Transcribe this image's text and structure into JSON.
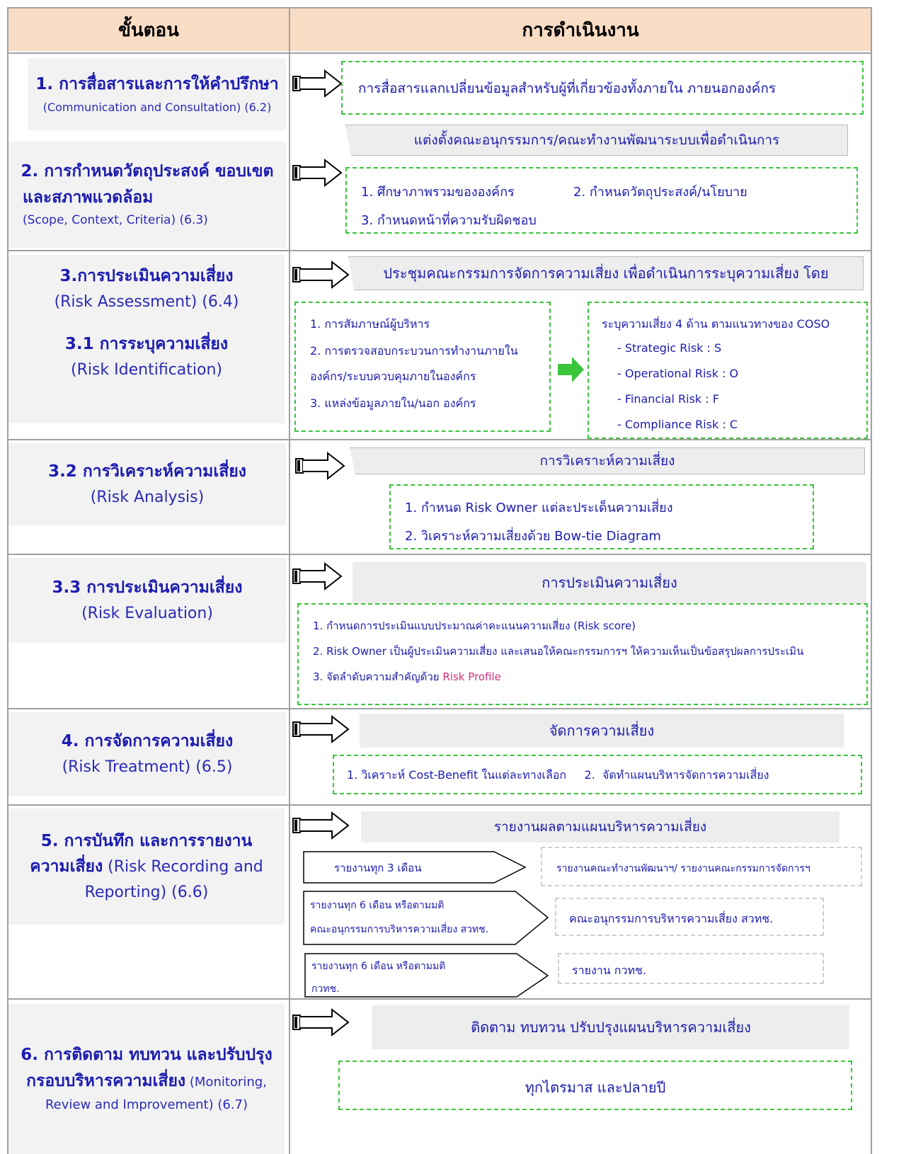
{
  "header": {
    "col1": "ขั้นตอน",
    "col2": "การดำเนินงาน"
  },
  "steps": {
    "s1": {
      "title": "1. การสื่อสารและการให้คำปรึกษา",
      "sub": "(Communication and Consultation) (6.2)",
      "box": "การสื่อสารแลกเปลี่ยนข้อมูลสำหรับผู้ที่เกี่ยวข้องทั้งภายใน ภายนอกองค์กร"
    },
    "s2": {
      "title1": "2. การกำหนดวัตถุประสงค์ ขอบเขต",
      "title2": "และสภาพแวดล้อม",
      "sub": "(Scope, Context, Criteria) (6.3)",
      "banner": "แต่งตั้งคณะอนุกรรมการ/คณะทำงานพัฒนาระบบเพื่อดำเนินการ",
      "item1": "1. ศึกษาภาพรวมขององค์กร",
      "item2": "2. กำหนดวัตถุประสงค์/นโยบาย",
      "item3": "3. กำหนดหน้าที่ความรับผิดชอบ"
    },
    "s3": {
      "title": "3.การประเมินความเสี่ยง",
      "sub": "(Risk Assessment) (6.4)",
      "title31": "3.1 การระบุความเสี่ยง",
      "sub31": "(Risk Identification)",
      "banner": "ประชุมคณะกรรมการจัดการความเสี่ยง เพื่อดำเนินการระบุความเสี่ยง โดย",
      "left1": "1. การสัมภาษณ์ผู้บริหาร",
      "left2": "2. การตรวจสอบกระบวนการทำงานภายใน",
      "left2b": "องค์กร/ระบบควบคุมภายในองค์กร",
      "left3": "3. แหล่งข้อมูลภายใน/นอก องค์กร",
      "right_title": "ระบุความเสี่ยง 4 ด้าน ตามแนวทางของ COSO",
      "r1": "- Strategic Risk : S",
      "r2": "- Operational Risk : O",
      "r3": "- Financial Risk : F",
      "r4": "- Compliance Risk : C"
    },
    "s32": {
      "title": "3.2 การวิเคราะห์ความเสี่ยง",
      "sub": "(Risk Analysis)",
      "banner": "การวิเคราะห์ความเสี่ยง",
      "item1": "1. กำหนด Risk Owner แต่ละประเด็นความเสี่ยง",
      "item2": "2. วิเคราะห์ความเสี่ยงด้วย Bow-tie Diagram"
    },
    "s33": {
      "title": "3.3 การประเมินความเสี่ยง",
      "sub": "(Risk Evaluation)",
      "banner": "การประเมินความเสี่ยง",
      "item1": "1. กำหนดการประเมินแบบประมาณค่าคะแนนความเสี่ยง (Risk score)",
      "item2": "2. Risk Owner เป็นผู้ประเมินความเสี่ยง และเสนอให้คณะกรรมการฯ ให้ความเห็นเป็นข้อสรุปผลการประเมิน",
      "item3a": "3. จัดลำดับความสำคัญด้วย ",
      "item3b": "Risk Profile"
    },
    "s4": {
      "title": "4. การจัดการความเสี่ยง",
      "sub": "(Risk Treatment) (6.5)",
      "banner": "จัดการความเสี่ยง",
      "item": "1. วิเคราะห์ Cost-Benefit ในแต่ละทางเลือก     2.  จัดทำแผนบริหารจัดการความเสี่ยง"
    },
    "s5": {
      "title1a": "5. การบันทึก และการรายงาน",
      "title2a": "ความเสี่ยง",
      "title2b": " (Risk Recording and",
      "title3": "Reporting) (6.6)",
      "banner": "รายงานผลตามแผนบริหารความเสี่ยง",
      "p1": "รายงานทุก  3 เดือน",
      "p1box": "รายงานคณะทำงานพัฒนาฯ/ รายงานคณะกรรมการจัดการฯ",
      "p2a": "รายงานทุก  6 เดือน หรือตามมติ",
      "p2b": "คณะอนุกรรมการบริหารความเสี่ยง สวทช.",
      "p2box": "คณะอนุกรรมการบริหารความเสี่ยง สวทช.",
      "p3a": "รายงานทุก 6 เดือน หรือตามมติ",
      "p3b": "กวทช.",
      "p3box": "รายงาน กวทช."
    },
    "s6": {
      "title1": "6. การติดตาม ทบทวน และปรับปรุง",
      "title2a": "กรอบบริหารความเสี่ยง",
      "title2b": " (Monitoring,",
      "title3": "Review and Improvement) (6.7)",
      "banner": "ติดตาม ทบทวน ปรับปรุงแผนบริหารความเสี่ยง",
      "box": "ทุกไตรมาส และปลายปี"
    }
  },
  "colors": {
    "header_bg": "#f9dcc4",
    "text": "#1c1cb0",
    "dash": "#3ac43a",
    "arrow_green": "#3ac43a",
    "pink": "#d6307a"
  }
}
